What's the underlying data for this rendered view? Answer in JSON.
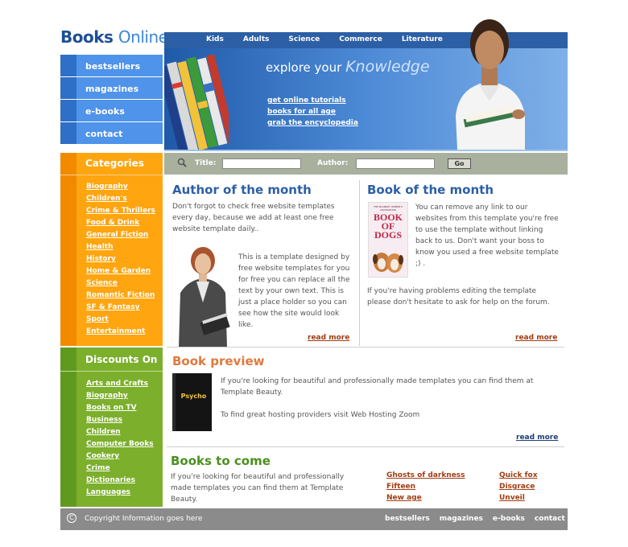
{
  "logo": {
    "part1": "Books",
    "part2": "Online"
  },
  "top_nav": [
    "Kids",
    "Adults",
    "Science",
    "Commerce",
    "Literature"
  ],
  "banner": {
    "explore": "explore your",
    "knowledge": "Knowledge",
    "links": [
      "get online tutorials",
      "books for all age",
      "grab the encyclopedia"
    ]
  },
  "left_menu": [
    "bestsellers",
    "magazines",
    "e-books",
    "contact"
  ],
  "search": {
    "title_label": "Title:",
    "author_label": "Author:",
    "go_label": "Go",
    "title_value": "",
    "author_value": ""
  },
  "categories": {
    "title": "Categories",
    "items": [
      "Biography",
      "Children's",
      "Crime & Thrillers",
      "Food & Drink",
      "General Fiction",
      "Health",
      "History",
      "Home & Garden",
      "Science",
      "Romantic Fiction",
      "SF & Fantasy",
      "Sport",
      "Entertainment"
    ]
  },
  "discounts": {
    "title": "Discounts On",
    "items": [
      "Arts and Crafts",
      "Biography",
      "Books on TV",
      "Business",
      "Children",
      "Computer Books",
      "Cookery",
      "Crime",
      "Dictionaries",
      "Languages"
    ]
  },
  "author_month": {
    "title": "Author of the month",
    "intro": "Don't forgot to check free website templates every day, because we add at least one free website template daily..",
    "body": "This is a template designed by free website templates for you for free you can replace all the text by your own text. This is just a place holder so you can see how the site would look like.",
    "read_more": "read more"
  },
  "book_month": {
    "title": "Book of the month",
    "body": "You can remove any link to our websites from this template you're free to use the template without linking back to us. Don't want your boss to know you used a free website template ;) .",
    "body2": "If you're having problems editing the template please don't hesitate to ask for help on the forum.",
    "read_more": "read more",
    "cover_small": "THE BLANKET OWNER'S CROSSWORD",
    "cover_title": "BOOK OF DOGS"
  },
  "book_preview": {
    "title": "Book preview",
    "p1": "If you're looking for beautiful and professionally made templates you can find them at Template Beauty.",
    "p2": "To find great hosting providers visit Web Hosting Zoom",
    "read_more": "read more",
    "cover_title": "Psycho"
  },
  "books_to_come": {
    "title": "Books to come",
    "body": "If you're looking for beautiful and professionally made templates you can find them at Template Beauty.",
    "col1": [
      "Ghosts of darkness",
      "Fifteen",
      "New age"
    ],
    "col2": [
      "Quick fox",
      "Disgrace",
      "Unveil"
    ]
  },
  "footer": {
    "copyright": "Copyright Information goes here",
    "links": [
      "bestsellers",
      "magazines",
      "e-books",
      "contact"
    ]
  },
  "colors": {
    "nav_blue": "#2c5fa5",
    "menu_blue": "#4f93ea",
    "orange": "#fea50f",
    "green": "#7caf2c",
    "footer_gray": "#8b8b8b",
    "search_gray": "#a9b19e"
  }
}
